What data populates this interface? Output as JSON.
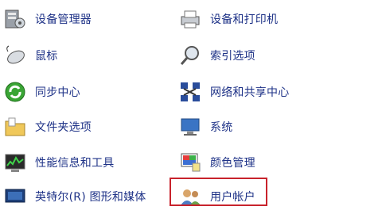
{
  "items_left": [
    {
      "label": "设备管理器",
      "icon": "device-manager-icon"
    },
    {
      "label": "鼠标",
      "icon": "mouse-icon"
    },
    {
      "label": "同步中心",
      "icon": "sync-center-icon"
    },
    {
      "label": "文件夹选项",
      "icon": "folder-options-icon"
    },
    {
      "label": "性能信息和工具",
      "icon": "performance-icon"
    },
    {
      "label": "英特尔(R) 图形和媒体",
      "icon": "intel-graphics-icon"
    }
  ],
  "items_right": [
    {
      "label": "设备和打印机",
      "icon": "printer-icon"
    },
    {
      "label": "索引选项",
      "icon": "indexing-icon"
    },
    {
      "label": "网络和共享中心",
      "icon": "network-icon"
    },
    {
      "label": "系统",
      "icon": "system-icon"
    },
    {
      "label": "颜色管理",
      "icon": "color-management-icon"
    },
    {
      "label": "用户帐户",
      "icon": "user-accounts-icon"
    }
  ],
  "highlight_color": "#c8232c",
  "link_color": "#1e3287"
}
